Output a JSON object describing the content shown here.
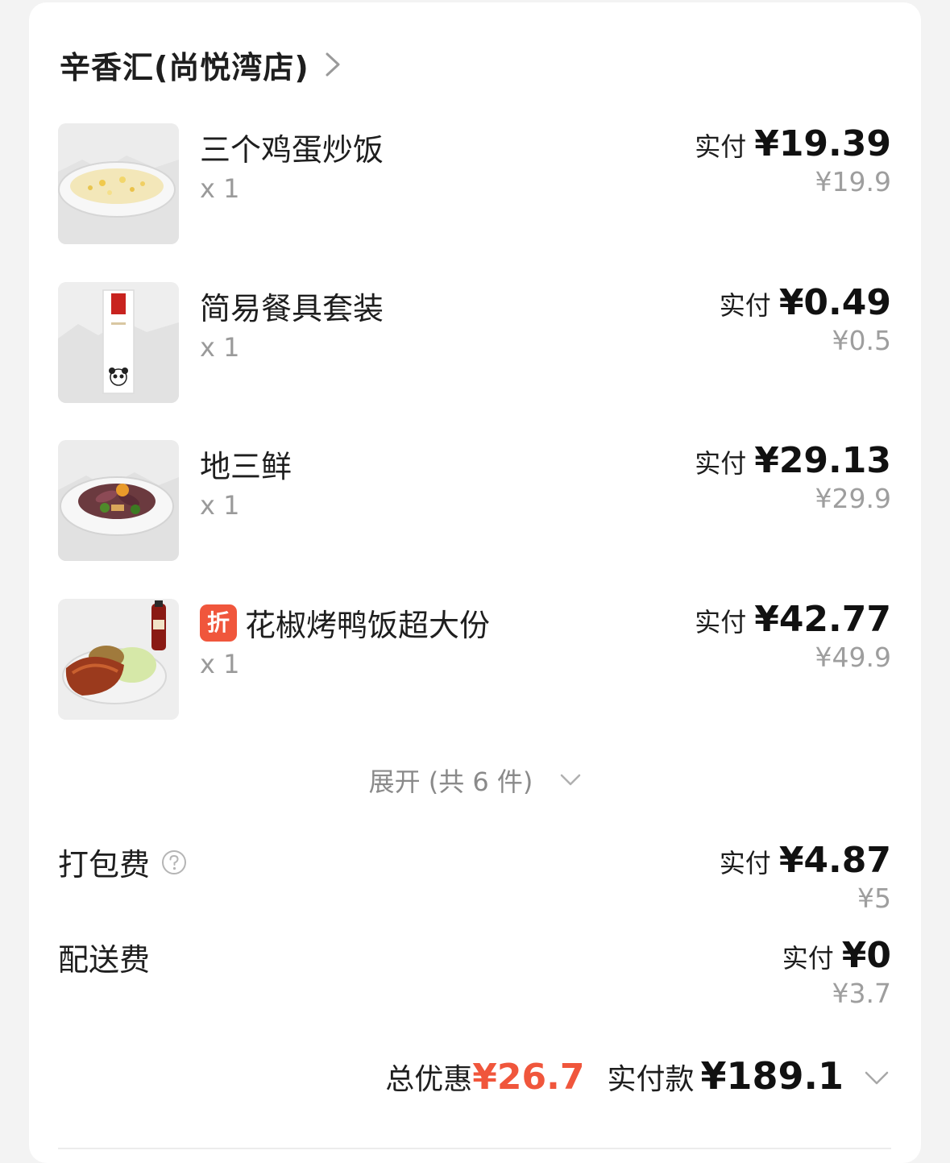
{
  "store": {
    "name": "辛香汇(尚悦湾店)"
  },
  "items": [
    {
      "name": "三个鸡蛋炒饭",
      "qty": "x 1",
      "paid_label": "实付",
      "paid": "¥19.39",
      "original": "¥19.9",
      "tag": ""
    },
    {
      "name": "简易餐具套装",
      "qty": "x 1",
      "paid_label": "实付",
      "paid": "¥0.49",
      "original": "¥0.5",
      "tag": ""
    },
    {
      "name": "地三鲜",
      "qty": "x 1",
      "paid_label": "实付",
      "paid": "¥29.13",
      "original": "¥29.9",
      "tag": ""
    },
    {
      "name": "花椒烤鸭饭超大份",
      "qty": "x 1",
      "paid_label": "实付",
      "paid": "¥42.77",
      "original": "¥49.9",
      "tag": "折"
    }
  ],
  "expand": {
    "label": "展开 (共 6 件)"
  },
  "fees": {
    "packing": {
      "label": "打包费",
      "paid_label": "实付",
      "paid": "¥4.87",
      "original": "¥5"
    },
    "delivery": {
      "label": "配送费",
      "paid_label": "实付",
      "paid": "¥0",
      "original": "¥3.7"
    }
  },
  "summary": {
    "discount_label": "总优惠",
    "discount_value": "¥26.7",
    "paid_label": "实付款",
    "paid_value": "¥189.1"
  },
  "colors": {
    "accent": "#f0563c",
    "muted": "#9e9e9e",
    "text": "#1e1e1e"
  },
  "icons": {
    "store_chevron": "chevron-right-icon",
    "expand_chevron": "chevron-down-icon",
    "help": "question-circle-icon",
    "summary_chevron": "chevron-down-icon"
  }
}
